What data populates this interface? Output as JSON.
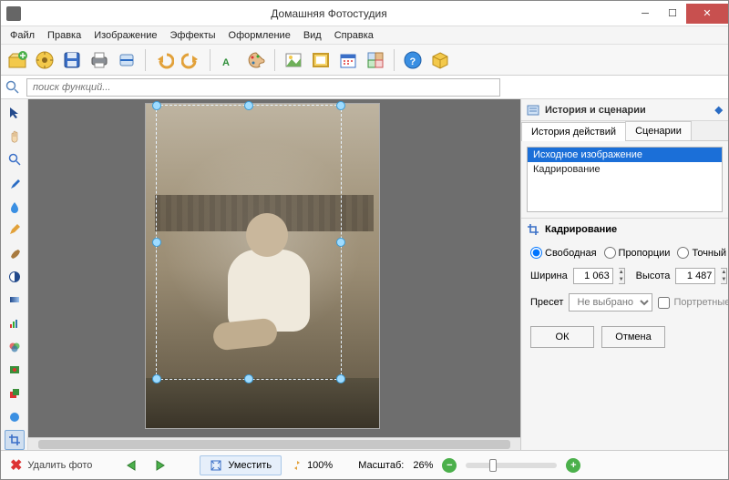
{
  "window": {
    "title": "Домашняя Фотостудия"
  },
  "menu": [
    "Файл",
    "Правка",
    "Изображение",
    "Эффекты",
    "Оформление",
    "Вид",
    "Справка"
  ],
  "toolbar_icons": [
    "open",
    "export",
    "save",
    "print",
    "scan",
    "undo",
    "redo",
    "text",
    "palette",
    "image",
    "frame-y",
    "calendar",
    "collage",
    "help",
    "package"
  ],
  "search": {
    "placeholder": "поиск функций..."
  },
  "left_tools": [
    "pointer",
    "hand",
    "zoom",
    "eyedropper",
    "drop",
    "pencil",
    "brush",
    "contrast",
    "gradient",
    "levels",
    "channels",
    "redeye",
    "layers",
    "round",
    "crop"
  ],
  "right": {
    "panel_title": "История и сценарии",
    "tabs": {
      "history": "История действий",
      "scenarios": "Сценарии"
    },
    "history_items": [
      "Исходное изображение",
      "Кадрирование"
    ],
    "history_selected": 0,
    "crop_section": {
      "title": "Кадрирование",
      "radios": {
        "free": "Свободная",
        "prop": "Пропорции",
        "exact": "Точный размер",
        "selected": "free"
      },
      "width_label": "Ширина",
      "width_value": "1 063",
      "height_label": "Высота",
      "height_value": "1 487",
      "preset_label": "Пресет",
      "preset_value": "Не выбрано",
      "portrait_label": "Портретные",
      "ok": "ОК",
      "cancel": "Отмена"
    }
  },
  "footer": {
    "remove": "Удалить фото",
    "fit": "Уместить",
    "zoom_100": "100%",
    "scale_label": "Масштаб:",
    "scale_value": "26%"
  },
  "colors": {
    "accent": "#1b6fd8",
    "close": "#c8504f",
    "canvas": "#6e6e6e"
  }
}
